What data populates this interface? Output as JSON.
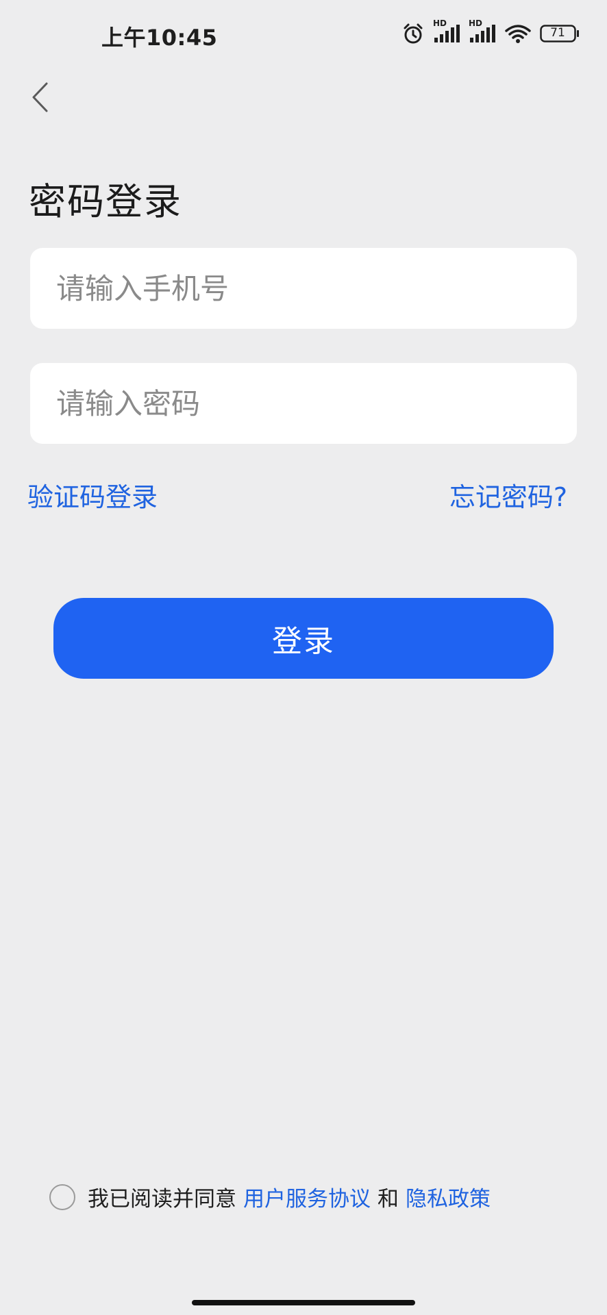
{
  "status_bar": {
    "time": "上午10:45",
    "signal1_label": "HD",
    "signal2_label": "HD",
    "battery": "71",
    "icons": [
      "alarm-icon",
      "signal-icon",
      "signal-icon",
      "wifi-icon",
      "battery-icon"
    ]
  },
  "header": {
    "back_icon": "chevron-left-icon",
    "title": "密码登录"
  },
  "form": {
    "phone_placeholder": "请输入手机号",
    "phone_value": "",
    "password_placeholder": "请输入密码",
    "password_value": "",
    "sms_login_link": "验证码登录",
    "forgot_password_link": "忘记密码?",
    "login_button": "登录"
  },
  "agreement": {
    "checked": false,
    "prefix": "我已阅读并同意",
    "terms_link": "用户服务协议",
    "conjunction": "和",
    "privacy_link": "隐私政策"
  },
  "colors": {
    "accent": "#1f63f2",
    "link": "#1f63e0",
    "background": "#ededee"
  }
}
